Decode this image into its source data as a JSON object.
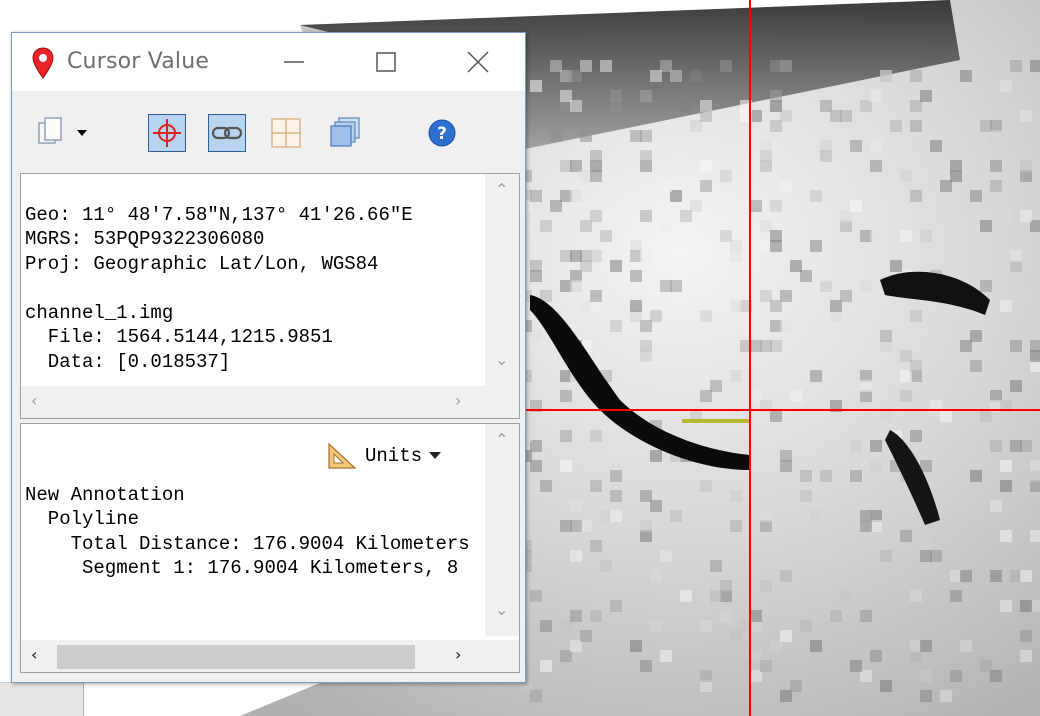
{
  "window": {
    "title": "Cursor Value",
    "icon": "map-pin-icon",
    "controls": {
      "minimize": "minimize-icon",
      "maximize": "maximize-icon",
      "close": "close-icon"
    }
  },
  "toolbar": {
    "buttons": [
      {
        "icon": "copy-dropdown-icon",
        "pressed": false
      },
      {
        "icon": "crosshair-icon",
        "pressed": true
      },
      {
        "icon": "link-icon",
        "pressed": true
      },
      {
        "icon": "grid-icon",
        "pressed": false
      },
      {
        "icon": "layers-icon",
        "pressed": false
      },
      {
        "icon": "help-icon",
        "pressed": false
      }
    ]
  },
  "cursor_info": {
    "geo": "Geo: 11° 48′7.58″N,137° 41′26.66″E",
    "mgrs": "MGRS: 53PQP9322306080",
    "proj": "Proj: Geographic Lat/Lon, WGS84",
    "layer": "channel_1.img",
    "file": "  File: 1564.5144,1215.9851",
    "data": "  Data: [0.018537]"
  },
  "annotation": {
    "units_label": "Units",
    "line1": "New Annotation",
    "line2": "  Polyline",
    "line3": "    Total Distance: 176.9004 Kilometers",
    "line4": "     Segment 1: 176.9004 Kilometers, 8"
  },
  "colors": {
    "crosshair": "#ff0000",
    "polyline": "#b8b830",
    "pressed_bg": "#b8d3ee"
  }
}
